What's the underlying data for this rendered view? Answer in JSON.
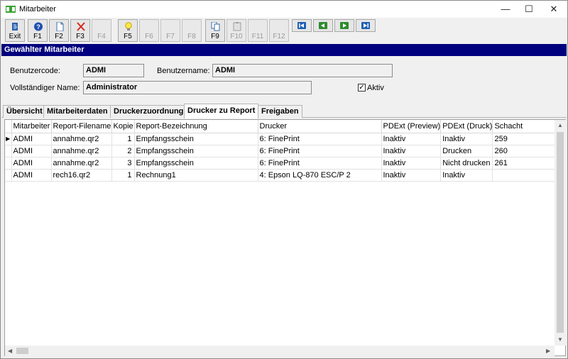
{
  "window": {
    "title": "Mitarbeiter",
    "icon": "pd-app-icon"
  },
  "toolbar": {
    "buttons": [
      {
        "label": "Exit",
        "icon": "exit-door-icon",
        "enabled": true
      },
      {
        "label": "F1",
        "icon": "help-icon",
        "enabled": true
      },
      {
        "label": "F2",
        "icon": "new-document-icon",
        "enabled": true
      },
      {
        "label": "F3",
        "icon": "delete-x-icon",
        "enabled": true
      },
      {
        "label": "F4",
        "icon": "",
        "enabled": false
      },
      {
        "label": "F5",
        "icon": "lightbulb-icon",
        "enabled": true
      },
      {
        "label": "F6",
        "icon": "",
        "enabled": false
      },
      {
        "label": "F7",
        "icon": "",
        "enabled": false
      },
      {
        "label": "F8",
        "icon": "",
        "enabled": false
      },
      {
        "label": "F9",
        "icon": "copy-icon",
        "enabled": true
      },
      {
        "label": "F10",
        "icon": "paste-icon",
        "enabled": false
      },
      {
        "label": "F11",
        "icon": "",
        "enabled": false
      },
      {
        "label": "F12",
        "icon": "",
        "enabled": false
      }
    ],
    "nav": [
      "first-record-icon",
      "previous-record-icon",
      "next-record-icon",
      "last-record-icon"
    ]
  },
  "section": {
    "title": "Gewählter Mitarbeiter"
  },
  "form": {
    "benutzercode_label": "Benutzercode:",
    "benutzercode_value": "ADMI",
    "benutzername_label": "Benutzername:",
    "benutzername_value": "ADMI",
    "fullname_label": "Vollständiger Name:",
    "fullname_value": "Administrator",
    "aktiv_label": "Aktiv",
    "aktiv_checked": true
  },
  "tabs": [
    {
      "label": "Übersicht",
      "active": false
    },
    {
      "label": "Mitarbeiterdaten",
      "active": false
    },
    {
      "label": "Druckerzuordnung",
      "active": false
    },
    {
      "label": "Drucker zu Report",
      "active": true
    },
    {
      "label": "Freigaben",
      "active": false
    }
  ],
  "grid": {
    "columns": [
      "Mitarbeiter",
      "Report-Filename",
      "Kopie",
      "Report-Bezeichnung",
      "Drucker",
      "PDExt (Preview)",
      "PDExt (Druck)",
      "Schacht"
    ],
    "rows": [
      {
        "current": true,
        "cells": [
          "ADMI",
          "annahme.qr2",
          "1",
          "Empfangsschein",
          "6: FinePrint",
          "Inaktiv",
          "Inaktiv",
          "259"
        ]
      },
      {
        "current": false,
        "cells": [
          "ADMI",
          "annahme.qr2",
          "2",
          "Empfangsschein",
          "6: FinePrint",
          "Inaktiv",
          "Drucken",
          "260"
        ]
      },
      {
        "current": false,
        "cells": [
          "ADMI",
          "annahme.qr2",
          "3",
          "Empfangsschein",
          "6: FinePrint",
          "Inaktiv",
          "Nicht drucken",
          "261"
        ]
      },
      {
        "current": false,
        "cells": [
          "ADMI",
          "rech16.qr2",
          "1",
          "Rechnung1",
          "4: Epson LQ-870 ESC/P 2",
          "Inaktiv",
          "Inaktiv",
          ""
        ]
      }
    ]
  }
}
